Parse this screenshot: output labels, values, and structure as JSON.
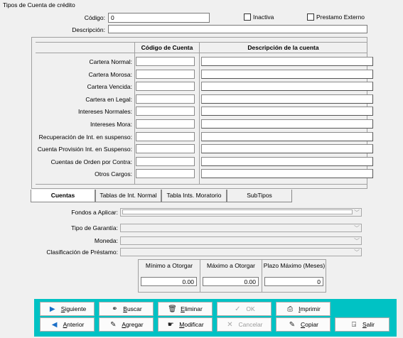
{
  "window": {
    "title": "Tipos de Cuenta de crédito"
  },
  "form": {
    "codigo_label": "Código:",
    "codigo_value": "0",
    "inactiva_label": "Inactiva",
    "prestamo_externo_label": "Prestamo Externo",
    "descripcion_label": "Descripción:",
    "descripcion_value": ""
  },
  "grid": {
    "col_codigo": "Código de Cuenta",
    "col_descripcion": "Descripción de la cuenta",
    "rows": [
      "Cartera Normal:",
      "Cartera Morosa:",
      "Cartera Vencida:",
      "Cartera en Legal:",
      "Intereses Normales:",
      "Intereses Mora:",
      "Recuperación de Int. en suspenso:",
      "Cuenta Provisión Int. en Suspenso:",
      "Cuentas de Orden por Contra:",
      "Otros Cargos:"
    ]
  },
  "tabs": [
    "Cuentas",
    "Tablas de Int. Normal",
    "Tabla Ints. Moratorio",
    "SubTipos"
  ],
  "lower": {
    "fondos_label": "Fondos a Aplicar:",
    "garantia_label": "Tipo de Garantía:",
    "moneda_label": "Moneda:",
    "clasificacion_label": "Clasificación de Préstamo:"
  },
  "limits": {
    "min_label": "Mínimo a Otorgar",
    "max_label": "Máximo a Otorgar",
    "plazo_label": "Plazo Máximo (Meses)",
    "min_value": "0.00",
    "max_value": "0.00",
    "plazo_value": "0"
  },
  "toolbar": {
    "siguiente": "Siguiente",
    "buscar": "Buscar",
    "eliminar": "Eliminar",
    "ok": "OK",
    "imprimir": "Imprimir",
    "anterior": "Anterior",
    "agregar": "Agregar",
    "modificar": "Modificar",
    "cancelar": "Cancelar",
    "copiar": "Copiar",
    "salir": "Salir"
  },
  "colors": {
    "toolbar_bg": "#00c2c4",
    "icon_blue": "#1b6fc7"
  },
  "icons": {
    "siguiente": "triangle-right-icon",
    "buscar": "binoculars-icon",
    "eliminar": "trash-icon",
    "ok": "checkmark-icon",
    "imprimir": "printer-icon",
    "anterior": "triangle-left-icon",
    "agregar": "pencil-icon",
    "modificar": "edit-hand-icon",
    "cancelar": "x-icon",
    "copiar": "pencil-copy-icon",
    "salir": "exit-door-icon"
  }
}
